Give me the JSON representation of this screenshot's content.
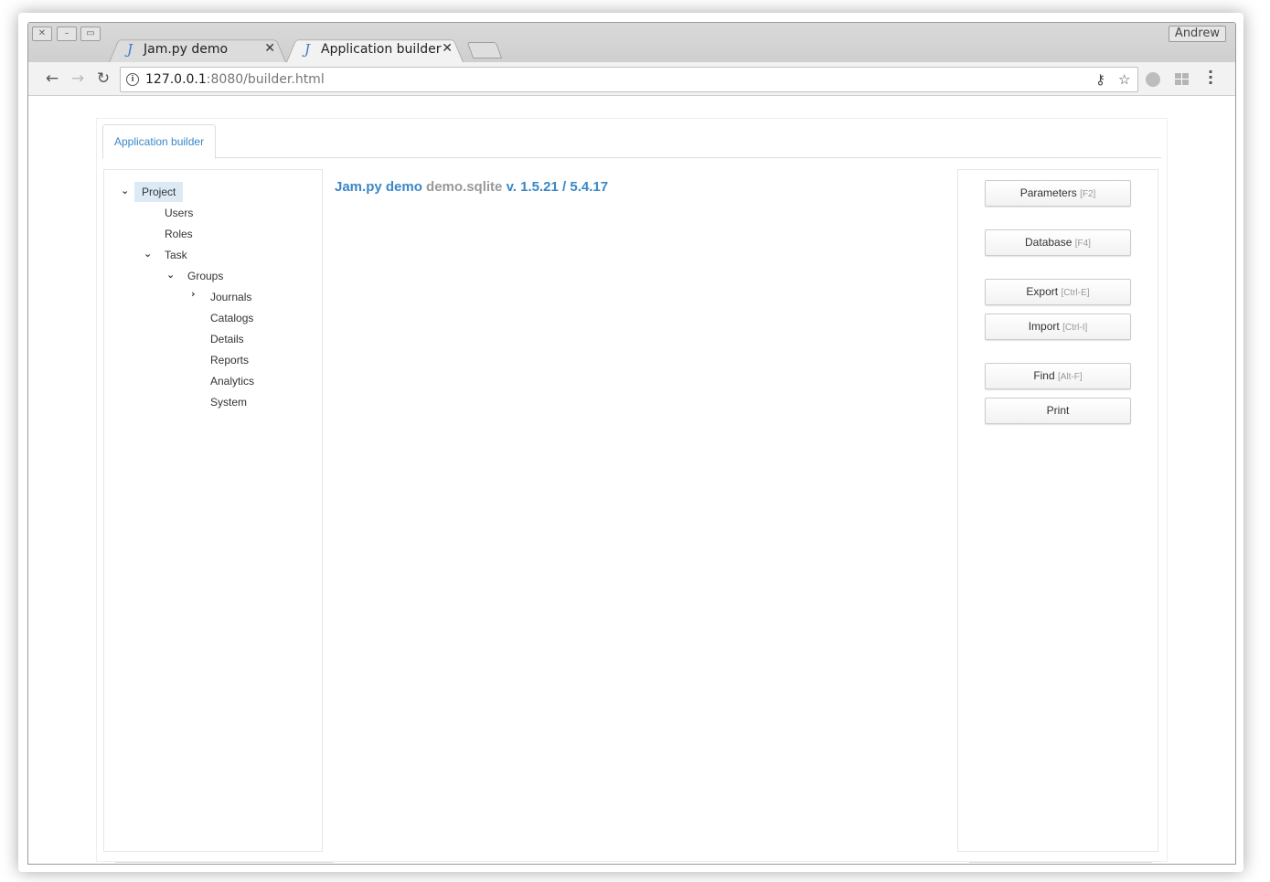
{
  "browser": {
    "tabs": [
      {
        "label": "Jam.py demo",
        "favicon": "J"
      },
      {
        "label": "Application builder",
        "favicon": "J"
      }
    ],
    "window_buttons": [
      "✕",
      "–",
      "▭"
    ],
    "user": "Andrew",
    "url_host": "127.0.0.1",
    "url_rest": ":8080/builder.html"
  },
  "app": {
    "tab_label": "Application builder",
    "heading": {
      "app_name": "Jam.py demo",
      "database": "demo.sqlite",
      "version": "v. 1.5.21 / 5.4.17"
    },
    "tree": {
      "project": "Project",
      "users": "Users",
      "roles": "Roles",
      "task": "Task",
      "groups": "Groups",
      "journals": "Journals",
      "catalogs": "Catalogs",
      "details": "Details",
      "reports": "Reports",
      "analytics": "Analytics",
      "system": "System"
    },
    "buttons": {
      "parameters": {
        "label": "Parameters",
        "key": "[F2]"
      },
      "database": {
        "label": "Database",
        "key": "[F4]"
      },
      "export": {
        "label": "Export",
        "key": "[Ctrl-E]"
      },
      "import": {
        "label": "Import",
        "key": "[Ctrl-I]"
      },
      "find": {
        "label": "Find",
        "key": "[Alt-F]"
      },
      "print": {
        "label": "Print"
      }
    }
  }
}
